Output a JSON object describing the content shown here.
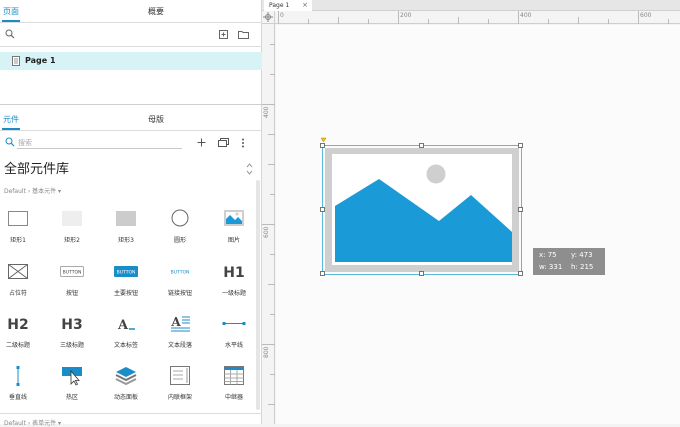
{
  "pages_panel": {
    "tabs": [
      {
        "label": "页面",
        "active": true
      },
      {
        "label": "概要",
        "active": false
      }
    ],
    "pages": [
      {
        "label": "Page 1",
        "selected": true
      }
    ]
  },
  "widgets_panel": {
    "tabs": [
      {
        "label": "元件",
        "active": true
      },
      {
        "label": "母版",
        "active": false
      }
    ],
    "search_placeholder": "搜索",
    "library_title": "全部元件库",
    "breadcrumb": "Default › 基本元件 ▾",
    "bottom_breadcrumb": "Default › 表单元件 ▾",
    "items": [
      {
        "label": "矩形1",
        "icon": "rect-white-icon"
      },
      {
        "label": "矩形2",
        "icon": "rect-lightgray-icon"
      },
      {
        "label": "矩形3",
        "icon": "rect-gray-icon"
      },
      {
        "label": "圆形",
        "icon": "circle-icon"
      },
      {
        "label": "图片",
        "icon": "image-icon"
      },
      {
        "label": "占位符",
        "icon": "placeholder-icon"
      },
      {
        "label": "按钮",
        "icon": "button-icon",
        "glyph_text": "BUTTON"
      },
      {
        "label": "主要按钮",
        "icon": "primary-button-icon",
        "glyph_text": "BUTTON"
      },
      {
        "label": "链接按钮",
        "icon": "link-button-icon",
        "glyph_text": "BUTTON"
      },
      {
        "label": "一级标题",
        "icon": "h1-icon",
        "glyph_text": "H1"
      },
      {
        "label": "二级标题",
        "icon": "h2-icon",
        "glyph_text": "H2"
      },
      {
        "label": "三级标题",
        "icon": "h3-icon",
        "glyph_text": "H3"
      },
      {
        "label": "文本标签",
        "icon": "text-label-icon",
        "glyph_text": "A_"
      },
      {
        "label": "文本段落",
        "icon": "text-paragraph-icon",
        "glyph_text": "A"
      },
      {
        "label": "水平线",
        "icon": "horizontal-line-icon"
      },
      {
        "label": "垂直线",
        "icon": "vertical-line-icon"
      },
      {
        "label": "热区",
        "icon": "hotspot-icon"
      },
      {
        "label": "动态面板",
        "icon": "dynamic-panel-icon"
      },
      {
        "label": "内联框架",
        "icon": "inline-frame-icon"
      },
      {
        "label": "中继器",
        "icon": "repeater-icon"
      }
    ]
  },
  "canvas": {
    "tab_label": "Page 1",
    "close_glyph": "×",
    "h_ruler_labels": [
      "0",
      "200",
      "400",
      "600"
    ],
    "v_ruler_labels": [
      "400",
      "600",
      "800"
    ],
    "readout": {
      "x": "x: 75",
      "y": "y: 473",
      "w": "w: 331",
      "h": "h: 215"
    }
  },
  "colors": {
    "accent": "#1a8dc8",
    "image_blue": "#1a9ad6",
    "image_frame": "#cfcfcf",
    "selection": "#5bb8d8"
  }
}
